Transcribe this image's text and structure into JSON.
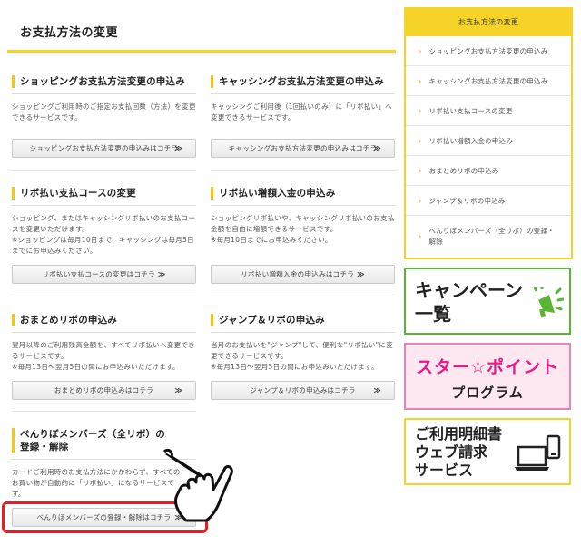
{
  "page_title": "お支払方法の変更",
  "sections": [
    {
      "title": "ショッピングお支払方法変更の申込み",
      "desc": [
        "ショッピングご利用時のご指定お支払回数（方法）を変更できるサービスです。"
      ],
      "button": "ショッピングお支払方法変更の申込みはコチラ"
    },
    {
      "title": "キャッシングお支払方法変更の申込み",
      "desc": [
        "キャッシングご利用後（1回払いのみ）に「リボ払い」へ変更できるサービスです。"
      ],
      "button": "キャッシングお支払方法変更の申込みはコチラ"
    },
    {
      "title": "リボ払い支払コースの変更",
      "desc": [
        "ショッピング、またはキャッシングリボ払いのお支払コースを変更いただけます。",
        "※ショッピングは毎月10日まで、キャッシングは毎月5日までにお申込みください。"
      ],
      "button": "リボ払い支払コースの変更はコチラ"
    },
    {
      "title": "リボ払い増額入金の申込み",
      "desc": [
        "ショッピングリボ払いや、キャッシングリボ払いのお支払金額を自由に増額できるサービスです。",
        "※毎月10日までにお申込みください。"
      ],
      "button": "リボ払い増額入金の申込みはコチラ"
    },
    {
      "title": "おまとめリボの申込み",
      "desc": [
        "翌月以降のご利用残高全額を、すべてリボ払いへ変更できるサービスです。",
        "※毎月13日～翌月5日の間にお申込みいただけます。"
      ],
      "button": "おまとめリボの申込みはコチラ"
    },
    {
      "title": "ジャンプ＆リボの申込み",
      "desc": [
        "当月のお支払いを\"ジャンプ\"して、便利な\"リボ払い\"に変更できるサービスです。",
        "※毎月13日～翌月5日の間にお申込みいただけます。"
      ],
      "button": "ジャンプ＆リボの申込みはコチラ"
    },
    {
      "title_line1": "べんりぼメンバーズ（全リボ）の",
      "title_line2": "登録・解除",
      "desc": [
        "カードご利用時のお支払方法にかかわらず、すべてのお買い物が自動的に「リボ払い」になるサービスです。"
      ],
      "button": "べんりぼメンバーズの登録・解除はコチラ"
    }
  ],
  "arrow_glyph": "≫",
  "sidebar": {
    "heading": "お支払方法の変更",
    "items": [
      "ショッピングお支払方法変更の申込み",
      "キャッシングお支払方法変更の申込み",
      "リボ払い支払コースの変更",
      "リボ払い増額入金の申込み",
      "おまとめリボの申込み",
      "ジャンプ＆リボの申込み",
      "べんりぼメンバーズ（全リボ）の登録・解除"
    ],
    "chevron": "›"
  },
  "banners": {
    "campaign": {
      "line1": "キャンペーン",
      "line2": "一覧"
    },
    "star_point": {
      "line1": "スター☆ポイント",
      "line2": "プログラム"
    },
    "statement": {
      "line1": "ご利用明細書",
      "line2": "ウェブ請求",
      "line3": "サービス"
    }
  },
  "colors": {
    "accent_yellow": "#f5d328",
    "highlight_red": "#e61e25",
    "campaign_green": "#5ab534",
    "star_pink": "#e91a84"
  },
  "icons": [
    "megaphone-icon",
    "hand-pointer-icon",
    "laptop-phone-icon",
    "star-icon"
  ]
}
